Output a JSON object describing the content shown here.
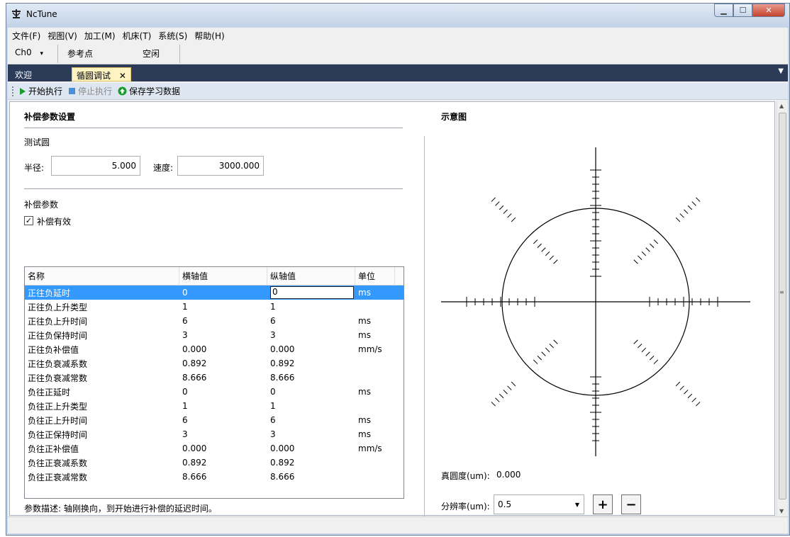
{
  "window": {
    "title": "NcTune"
  },
  "menu": [
    "文件(F)",
    "视图(V)",
    "加工(M)",
    "机床(T)",
    "系统(S)",
    "帮助(H)"
  ],
  "status": {
    "channel": "Ch0",
    "channel_arrow": "▾",
    "ref": "参考点",
    "state": "空闲"
  },
  "tabs": {
    "welcome": "欢迎",
    "active": "循圆调试",
    "close": "✕"
  },
  "toolbar": {
    "start": "开始执行",
    "stop": "停止执行",
    "save": "保存学习数据"
  },
  "left": {
    "section_title": "补偿参数设置",
    "test_circle": "测试圆",
    "radius_label": "半径:",
    "radius_value": "5.000",
    "speed_label": "速度:",
    "speed_value": "3000.000",
    "comp_params": "补偿参数",
    "comp_enabled_label": "补偿有效",
    "comp_enabled": true,
    "columns": [
      "名称",
      "横轴值",
      "纵轴值",
      "单位"
    ],
    "rows": [
      [
        "正往负延时",
        "0",
        "0",
        "ms"
      ],
      [
        "正往负上升类型",
        "1",
        "1",
        ""
      ],
      [
        "正往负上升时间",
        "6",
        "6",
        "ms"
      ],
      [
        "正往负保持时间",
        "3",
        "3",
        "ms"
      ],
      [
        "正往负补偿值",
        "0.000",
        "0.000",
        "mm/s"
      ],
      [
        "正往负衰减系数",
        "0.892",
        "0.892",
        ""
      ],
      [
        "正往负衰减常数",
        "8.666",
        "8.666",
        ""
      ],
      [
        "负往正延时",
        "0",
        "0",
        "ms"
      ],
      [
        "负往正上升类型",
        "1",
        "1",
        ""
      ],
      [
        "负往正上升时间",
        "6",
        "6",
        "ms"
      ],
      [
        "负往正保持时间",
        "3",
        "3",
        "ms"
      ],
      [
        "负往正补偿值",
        "0.000",
        "0.000",
        "mm/s"
      ],
      [
        "负往正衰减系数",
        "0.892",
        "0.892",
        ""
      ],
      [
        "负往正衰减常数",
        "8.666",
        "8.666",
        ""
      ]
    ],
    "selected_row": 0,
    "description": "参数描述: 轴刚换向，到开始进行补偿的延迟时间。"
  },
  "right": {
    "title": "示意图",
    "roundness_label": "真圆度(um):",
    "roundness_value": "0.000",
    "resolution_label": "分辨率(um):",
    "resolution_value": "0.5",
    "plus": "+",
    "minus": "−"
  },
  "colors": {
    "selection": "#3399ff",
    "tab_bar": "#2b3b58",
    "active_tab": "#fff4c2",
    "start_green": "#1a9c2c",
    "stop_blue": "#4a90d9"
  }
}
